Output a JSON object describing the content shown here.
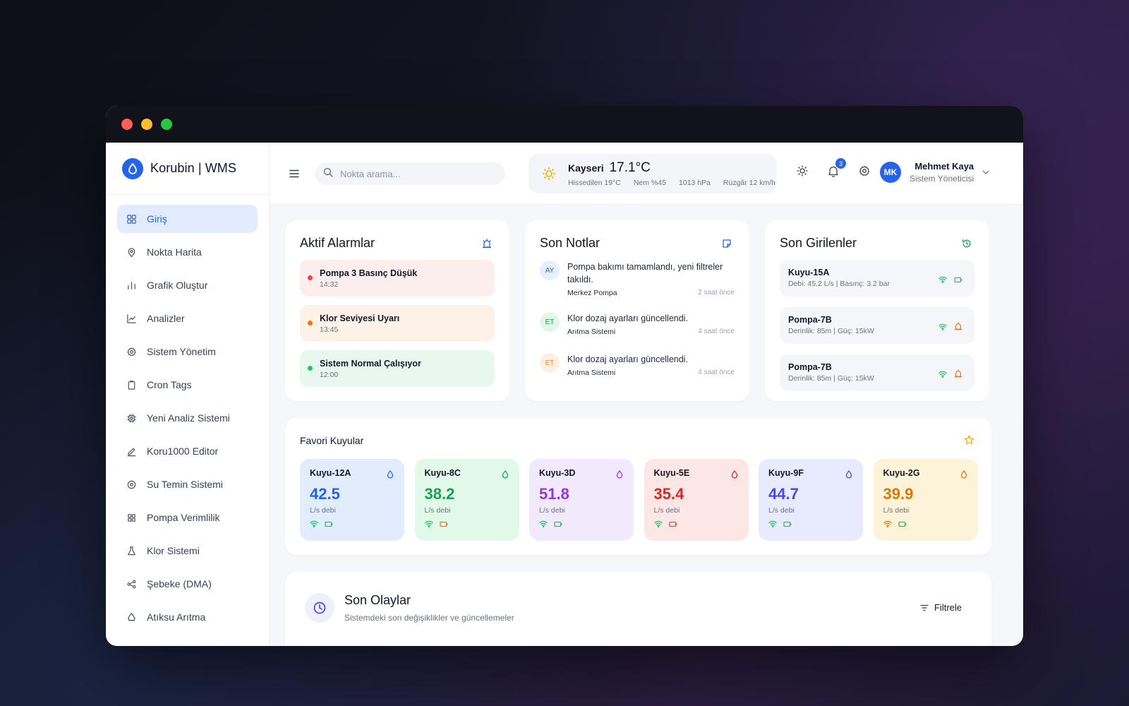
{
  "app": {
    "title": "Korubin | WMS"
  },
  "sidebar": {
    "items": [
      {
        "label": "Giriş",
        "icon": "grid-icon",
        "active": true
      },
      {
        "label": "Nokta Harita",
        "icon": "map-pin-icon"
      },
      {
        "label": "Grafik Oluştur",
        "icon": "bar-chart-icon"
      },
      {
        "label": "Analizler",
        "icon": "line-chart-icon"
      },
      {
        "label": "Sistem Yönetim",
        "icon": "gear-icon"
      },
      {
        "label": "Cron Tags",
        "icon": "clipboard-icon"
      },
      {
        "label": "Yeni Analiz Sistemi",
        "icon": "chip-icon"
      },
      {
        "label": "Koru1000 Editor",
        "icon": "pencil-icon"
      },
      {
        "label": "Su Temin Sistemi",
        "icon": "target-icon"
      },
      {
        "label": "Pompa Verimlilik",
        "icon": "grid-small-icon"
      },
      {
        "label": "Klor Sistemi",
        "icon": "flask-icon"
      },
      {
        "label": "Şebeke (DMA)",
        "icon": "network-icon"
      },
      {
        "label": "Atıksu Arıtma",
        "icon": "recycle-icon"
      }
    ]
  },
  "search": {
    "placeholder": "Nokta arama..."
  },
  "weather": {
    "city": "Kayseri",
    "temp": "17.1°C",
    "feels": "Hissedilen 19°C",
    "humidity": "Nem %45",
    "pressure": "1013 hPa",
    "wind": "Rüzgâr 12 km/h"
  },
  "notifications": {
    "count": "3"
  },
  "user": {
    "initials": "MK",
    "name": "Mehmet Kaya",
    "role": "Sistem Yöneticisi"
  },
  "alarms": {
    "title": "Aktif Alarmlar",
    "items": [
      {
        "title": "Pompa 3 Basınç Düşük",
        "time": "14:32",
        "bg": "#fdeeee",
        "dot": "#ef4444"
      },
      {
        "title": "Klor Seviyesi Uyarı",
        "time": "13:45",
        "bg": "#fdf2e8",
        "dot": "#f97316"
      },
      {
        "title": "Sistem Normal Çalışıyor",
        "time": "12:00",
        "bg": "#e9f8ee",
        "dot": "#22c55e"
      }
    ]
  },
  "notes": {
    "title": "Son Notlar",
    "items": [
      {
        "initials": "AY",
        "text": "Pompa bakımı tamamlandı, yeni filtreler takıldı.",
        "source": "Merkez Pompa",
        "time": "2 saat önce",
        "bg": "#e6efff",
        "fg": "#2563eb"
      },
      {
        "initials": "ET",
        "text": "Klor dozaj ayarları güncellendi.",
        "source": "Arıtma Sistemi",
        "time": "4 saat önce",
        "bg": "#e3f7e9",
        "fg": "#16a34a"
      },
      {
        "initials": "ET",
        "text": "Klor dozaj ayarları güncellendi.",
        "source": "Arıtma Sistemi",
        "time": "4 saat önce",
        "bg": "#fdf0e3",
        "fg": "#ea8a2e"
      }
    ]
  },
  "recent": {
    "title": "Son Girilenler",
    "items": [
      {
        "title": "Kuyu-15A",
        "sub": "Debi: 45.2 L/s | Basınç: 3.2 bar",
        "battery": "#22c55e"
      },
      {
        "title": "Pompa-7B",
        "sub": "Derinlik: 85m | Güç: 15kW",
        "battery": "#f97316"
      },
      {
        "title": "Pompa-7B",
        "sub": "Derinlik: 85m | Güç: 15kW",
        "battery": "#f97316"
      }
    ]
  },
  "favorites": {
    "title": "Favori Kuyular",
    "items": [
      {
        "name": "Kuyu-12A",
        "value": "42.5",
        "unit": "L/s debi",
        "bg": "#e1ecfd",
        "color": "#2563eb",
        "wifi": "#22c55e",
        "battery": "#22c55e"
      },
      {
        "name": "Kuyu-8C",
        "value": "38.2",
        "unit": "L/s debi",
        "bg": "#e2f8e9",
        "color": "#16a34a",
        "wifi": "#22c55e",
        "battery": "#f97316"
      },
      {
        "name": "Kuyu-3D",
        "value": "51.8",
        "unit": "L/s debi",
        "bg": "#f3e9fd",
        "color": "#9333ea",
        "wifi": "#22c55e",
        "battery": "#22c55e"
      },
      {
        "name": "Kuyu-5E",
        "value": "35.4",
        "unit": "L/s debi",
        "bg": "#fde6e6",
        "color": "#dc2626",
        "wifi": "#22c55e",
        "battery": "#ef4444"
      },
      {
        "name": "Kuyu-9F",
        "value": "44.7",
        "unit": "L/s debi",
        "bg": "#e8eafd",
        "color": "#4f46e5",
        "wifi": "#22c55e",
        "battery": "#22c55e"
      },
      {
        "name": "Kuyu-2G",
        "value": "39.9",
        "unit": "L/s debi",
        "bg": "#fdf3d9",
        "color": "#d97706",
        "wifi": "#f97316",
        "battery": "#22c55e"
      }
    ]
  },
  "events": {
    "title": "Son Olaylar",
    "subtitle": "Sistemdeki son değişiklikler ve güncellemeler",
    "filter_label": "Filtrele"
  }
}
